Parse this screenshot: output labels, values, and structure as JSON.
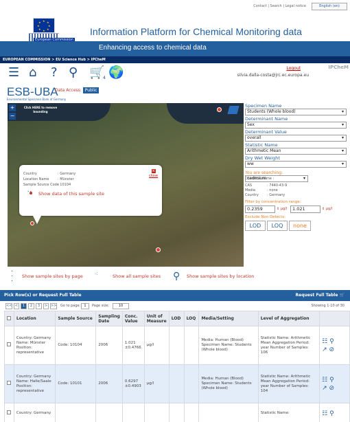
{
  "header": {
    "top_links": "Contact | Search | Legal notice",
    "language": "English (en)",
    "ec_label": "European Commission",
    "title": "Information Platform for Chemical Monitoring data",
    "subtitle": "Enhancing access to chemical data",
    "breadcrumb": "EUROPEAN COMMISSION > EU Science Hub > IPCheM"
  },
  "toolbar": {
    "cart_count": "4",
    "logout": "Logout",
    "user": "silvia.dalla-costa@jrc.ec.europa.eu",
    "brand": "IPCheM"
  },
  "source": {
    "name": "ESB-UBA",
    "full_name": "Environmental Specimen Bank of Germany",
    "access_label": "Data Access:",
    "access_value": "Public"
  },
  "map": {
    "zoom_in": "+",
    "zoom_out": "−",
    "tip": "Click HERE to remove bounding",
    "popup": {
      "country_label": "Country",
      "country": ": Germany",
      "location_label": "Location Name",
      "location": ": Münster",
      "code_label": "Sample Source Code",
      "code": ": 10104",
      "close": "close",
      "show": "Show data of this sample site"
    }
  },
  "filters": {
    "specimen_label": "Specimen Name",
    "specimen": "Students (Whole blood)",
    "determinant_label": "Determinant Name",
    "determinant": "Sex",
    "det_value_label": "Determinant Value",
    "det_value": "overall",
    "statistic_label": "Statistic Name",
    "statistic": "Arithmetic Mean",
    "weight_label": "Dry Wet Weight",
    "weight": "ww",
    "searching": "You are searching:",
    "chem_label": "Chemical name :",
    "chem": "cadmium",
    "cas_label": "CAS",
    "cas": ": 7440-43-9",
    "media_label": "Media",
    "media": ": none",
    "country_label": "Country",
    "country": ": Germany",
    "range_label": "Filter by concentration range:",
    "min": "0.2359",
    "max": "1.021",
    "unit": "µg/l",
    "nd_label": "Exclude Non Detects:",
    "lod": "LOD",
    "loq": "LOQ",
    "none": "none"
  },
  "actions": {
    "by_page": "Show sample sites by page",
    "all": "Show all sample sites",
    "by_location": "Show sample sites by location"
  },
  "table": {
    "bar_title": "Pick Row(s) or Request Full Table",
    "request_full": "Request Full Table",
    "pager": {
      "b1": "<<",
      "b2": "<",
      "p1": "1",
      "p2": "2",
      "p3": "3",
      "b3": ">",
      "b4": ">>",
      "goto": "Go to page:",
      "goto_val": "1",
      "size_label": "Page size:",
      "size": "10",
      "showing": "Showing 1-10 of 30"
    },
    "headers": [
      "Location",
      "Sample Source",
      "Sampling Date",
      "Conc. Value",
      "Unit of Measure",
      "LOD",
      "LOQ",
      "Media/Setting",
      "Level of Aggregation"
    ],
    "rows": [
      {
        "location": "Country: Germany Name: Münster Position: representative",
        "source": "Code: 10104",
        "date": "2006",
        "conc": "1.021 ±0.4766",
        "unit": "µg/l",
        "lod": "",
        "loq": "",
        "media": "Media: Human (Blood) Specimen Name: Students (Whole blood)",
        "agg": "Statistic Name: Arithmetic Mean Aggregation Period: year Number of Samples: 106"
      },
      {
        "location": "Country: Germany Name: Halle/Saale Position: representative",
        "source": "Code: 10101",
        "date": "2006",
        "conc": "0.6297 ±0.4903",
        "unit": "µg/l",
        "lod": "",
        "loq": "",
        "media": "Media: Human (Blood) Specimen Name: Students (Whole blood)",
        "agg": "Statistic Name: Arithmetic Mean Aggregation Period: year Number of Samples: 104"
      },
      {
        "location": "Country: Germany",
        "source": "",
        "date": "",
        "conc": "",
        "unit": "",
        "lod": "",
        "loq": "",
        "media": "",
        "agg": "Statistic Name:"
      }
    ]
  }
}
